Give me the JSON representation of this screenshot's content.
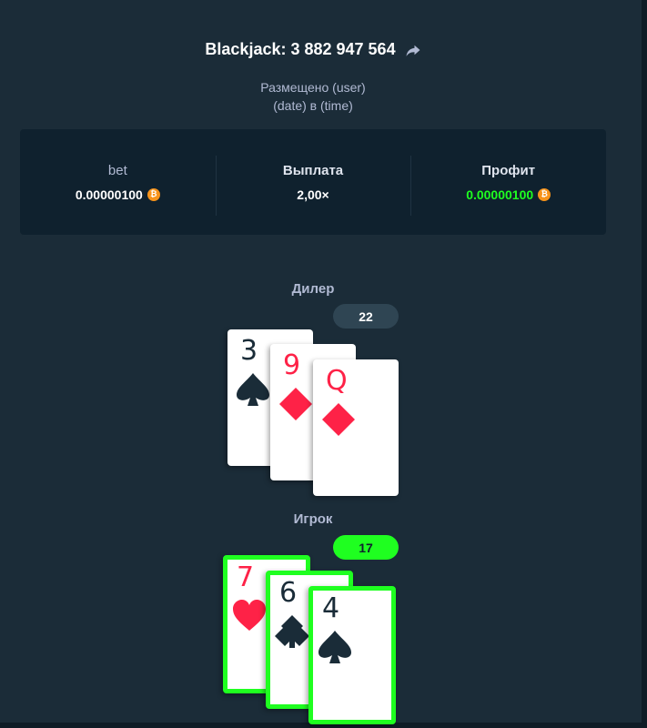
{
  "bet_title": "Blackjack: 3 882 947 564",
  "placed_by": "Размещено (user)",
  "placed_at": "(date) в (time)",
  "stats": {
    "bet_label": "bet",
    "bet_value": "0.00000100",
    "payout_label": "Выплата",
    "payout_value": "2,00×",
    "profit_label": "Профит",
    "profit_value": "0.00000100",
    "currency_icon": "bitcoin-icon",
    "profit_color": "#1fff20"
  },
  "dealer": {
    "label": "Дилер",
    "total": "22",
    "cards": [
      {
        "rank": "3",
        "suit": "spades"
      },
      {
        "rank": "9",
        "suit": "diamonds"
      },
      {
        "rank": "Q",
        "suit": "diamonds"
      }
    ]
  },
  "player": {
    "label": "Игрок",
    "total": "17",
    "cards": [
      {
        "rank": "7",
        "suit": "hearts"
      },
      {
        "rank": "6",
        "suit": "clubs"
      },
      {
        "rank": "4",
        "suit": "spades"
      }
    ]
  }
}
